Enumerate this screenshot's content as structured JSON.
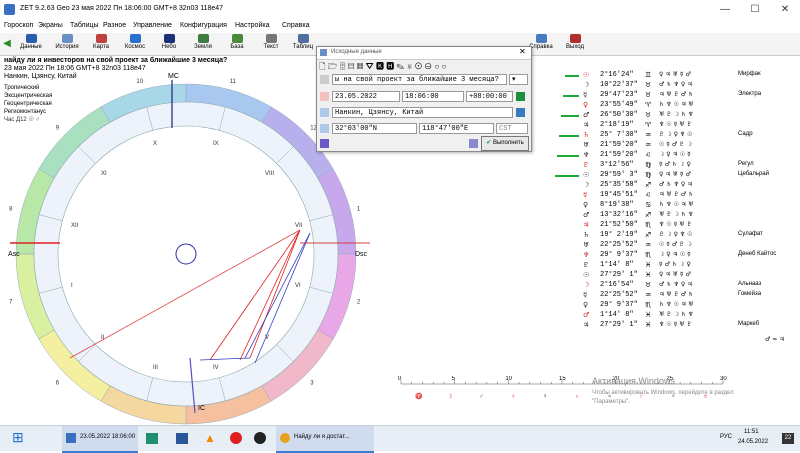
{
  "window": {
    "title": "ZET 9.2.63 Geo   23 мая 2022  Пн  18:06:00 GMT+8 32n03  118e47",
    "minimize": "—",
    "maximize": "☐",
    "close": "✕"
  },
  "menu": [
    "Гороскоп",
    "Экраны",
    "Таблицы",
    "Разное",
    "Управление",
    "Конфигурация",
    "Настройка",
    "Справка"
  ],
  "toolbar": [
    {
      "label": "Данные",
      "color": "#2a5db0"
    },
    {
      "label": "История",
      "color": "#6a8fc4"
    },
    {
      "label": "Карта",
      "color": "#c04040"
    },
    {
      "label": "Космос",
      "color": "#2b6fd1"
    },
    {
      "label": "Небо",
      "color": "#1b2f7a"
    },
    {
      "label": "Земля",
      "color": "#3f7c3f"
    },
    {
      "label": "База",
      "color": "#4a8a3a"
    },
    {
      "label": "Текст",
      "color": "#777777"
    },
    {
      "label": "Таблиц",
      "color": "#4f6f9f"
    }
  ],
  "toolbar_right": [
    {
      "label": "Справка",
      "color": "#4a7ac0"
    },
    {
      "label": "Выход",
      "color": "#b03030"
    }
  ],
  "info": {
    "question": "найду ли я инвесторов на свой проект за ближайшие 3 месяца?",
    "datetime": "23 мая 2022  Пн  18:06  GMT+8  32n03  118e47",
    "place": "Нанкин, Цзянсу, Китай",
    "zodiac": "Тропический",
    "coords": "Эксцентрическая",
    "system": "Геоцентрическая",
    "houses": "Региомонтанус",
    "hour": "Час Д12 ☉ ♂"
  },
  "chart": {
    "house_numbers": [
      "I",
      "II",
      "III",
      "IV",
      "V",
      "VI",
      "VII",
      "VIII",
      "IX",
      "X",
      "XI",
      "XII"
    ],
    "sign_numbers": [
      "10",
      "9",
      "8",
      "7",
      "6",
      "5",
      "4",
      "3",
      "2",
      "1",
      "12",
      "11"
    ],
    "mc_label": "MC",
    "ic_label": "IC",
    "asc_label": "Asc",
    "dsc_label": "Dsc"
  },
  "dialog": {
    "title": "Исходные данные",
    "question": "ы на свой проект за ближайшие 3 месяца?",
    "date": "23.05.2022",
    "time": "18:06:00",
    "timezone": "+08:00:00",
    "place": "Нанкин, Цзянсу, Китай",
    "latitude": "32°03'00\"N",
    "longitude": "118°47'00\"E",
    "tz_code": "CST",
    "run_button": "Выполнить"
  },
  "table": {
    "rows": [
      {
        "pos": "2°16'24\"",
        "sign": "♊",
        "star": "Мирфак"
      },
      {
        "pos": "10°22'37\"",
        "sign": "♉",
        "star": ""
      },
      {
        "pos": "29°47'23\"",
        "sign": "♉",
        "star": "Электра"
      },
      {
        "pos": "23°55'49\"",
        "sign": "♈",
        "star": ""
      },
      {
        "pos": "26°50'30\"",
        "sign": "♉",
        "star": ""
      },
      {
        "pos": "2°18'19\"",
        "sign": "♈",
        "star": ""
      },
      {
        "pos": "25° 7'30\"",
        "sign": "♒",
        "star": "Садр"
      },
      {
        "pos": "21°59'20\"",
        "sign": "♒",
        "star": ""
      },
      {
        "pos": "21°59'20\"",
        "sign": "♌",
        "star": ""
      },
      {
        "pos": "3°12'56\"",
        "sign": "♍",
        "star": "Регул"
      },
      {
        "pos": "29°59' 3\"",
        "sign": "♍",
        "star": "Цебальрай"
      },
      {
        "pos": "25°35'58\"",
        "sign": "♐",
        "star": ""
      },
      {
        "pos": "19°45'51\"",
        "sign": "♌",
        "star": ""
      },
      {
        "pos": "8°19'38\"",
        "sign": "♋",
        "star": ""
      },
      {
        "pos": "13°32'16\"",
        "sign": "♐",
        "star": ""
      },
      {
        "pos": "21°52'50\"",
        "sign": "♏",
        "star": ""
      },
      {
        "pos": "19° 2'19\"",
        "sign": "♐",
        "star": "Сулафат"
      },
      {
        "pos": "22°25'52\"",
        "sign": "♒",
        "star": ""
      },
      {
        "pos": "29° 9'37\"",
        "sign": "♏",
        "star": "Денеб Кайтос"
      },
      {
        "pos": "1°14' 8\"",
        "sign": "♓",
        "star": ""
      },
      {
        "pos": "27°29' 1\"",
        "sign": "♓",
        "star": ""
      },
      {
        "pos": "2°16'54\"",
        "sign": "♉",
        "star": "Альнааз"
      },
      {
        "pos": "22°25'52\"",
        "sign": "♒",
        "star": "Гомейза"
      },
      {
        "pos": "29° 9'37\"",
        "sign": "♏",
        "star": ""
      },
      {
        "pos": "1°14' 8\"",
        "sign": "♓",
        "star": ""
      },
      {
        "pos": "27°29' 1\"",
        "sign": "♓",
        "star": "Маркеб"
      }
    ],
    "footer": "♂ ≈ ♃"
  },
  "scale": {
    "ticks": [
      "0",
      "5",
      "10",
      "15",
      "20",
      "25",
      "30"
    ]
  },
  "watermark": {
    "line1": "Активация Windows",
    "line2": "Чтобы активировать Windows, перейдите в раздел",
    "line3": "\"Параметры\"."
  },
  "taskbar": {
    "start": "⊞",
    "app1": "23.05.2022  18:06:00",
    "browser_tab": "Найду ли я достат...",
    "lang": "РУС",
    "time": "11:51",
    "date": "24.05.2022",
    "notif": "22"
  }
}
